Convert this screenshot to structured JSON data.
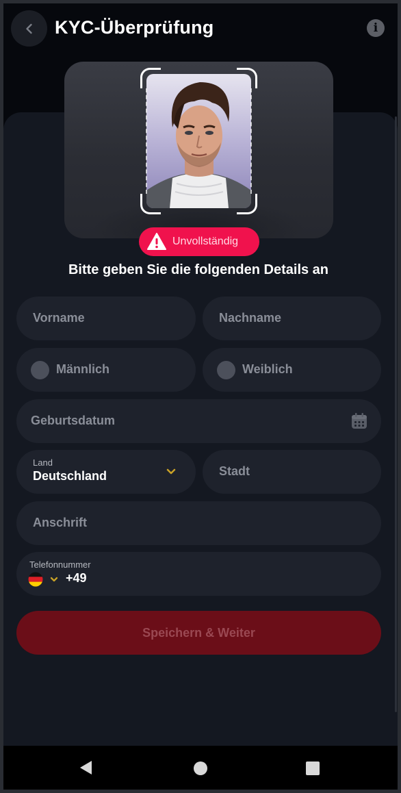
{
  "header": {
    "title": "KYC-Überprüfung"
  },
  "status": {
    "label": "Unvollständig",
    "color": "#f0124d"
  },
  "form": {
    "instruction": "Bitte geben Sie die folgenden Details an",
    "first_name_placeholder": "Vorname",
    "last_name_placeholder": "Nachname",
    "gender_male": "Männlich",
    "gender_female": "Weiblich",
    "birthdate_placeholder": "Geburtsdatum",
    "country_label": "Land",
    "country_value": "Deutschland",
    "city_placeholder": "Stadt",
    "address_placeholder": "Anschrift",
    "phone_label": "Telefonnummer",
    "phone_code": "+49",
    "submit_label": "Speichern & Weiter"
  },
  "colors": {
    "accent_red": "#f0124d",
    "submit_bg": "#6b0e18",
    "chevron_gold": "#c9a227",
    "background": "#06080d",
    "field_bg": "#1e222c"
  },
  "icons": {
    "back": "chevron-left-icon",
    "info": "info-icon",
    "warning": "warning-triangle-icon",
    "calendar": "calendar-icon",
    "flag": "germany-flag-icon",
    "nav_back": "triangle-back-icon",
    "nav_home": "circle-home-icon",
    "nav_recents": "square-recents-icon"
  }
}
